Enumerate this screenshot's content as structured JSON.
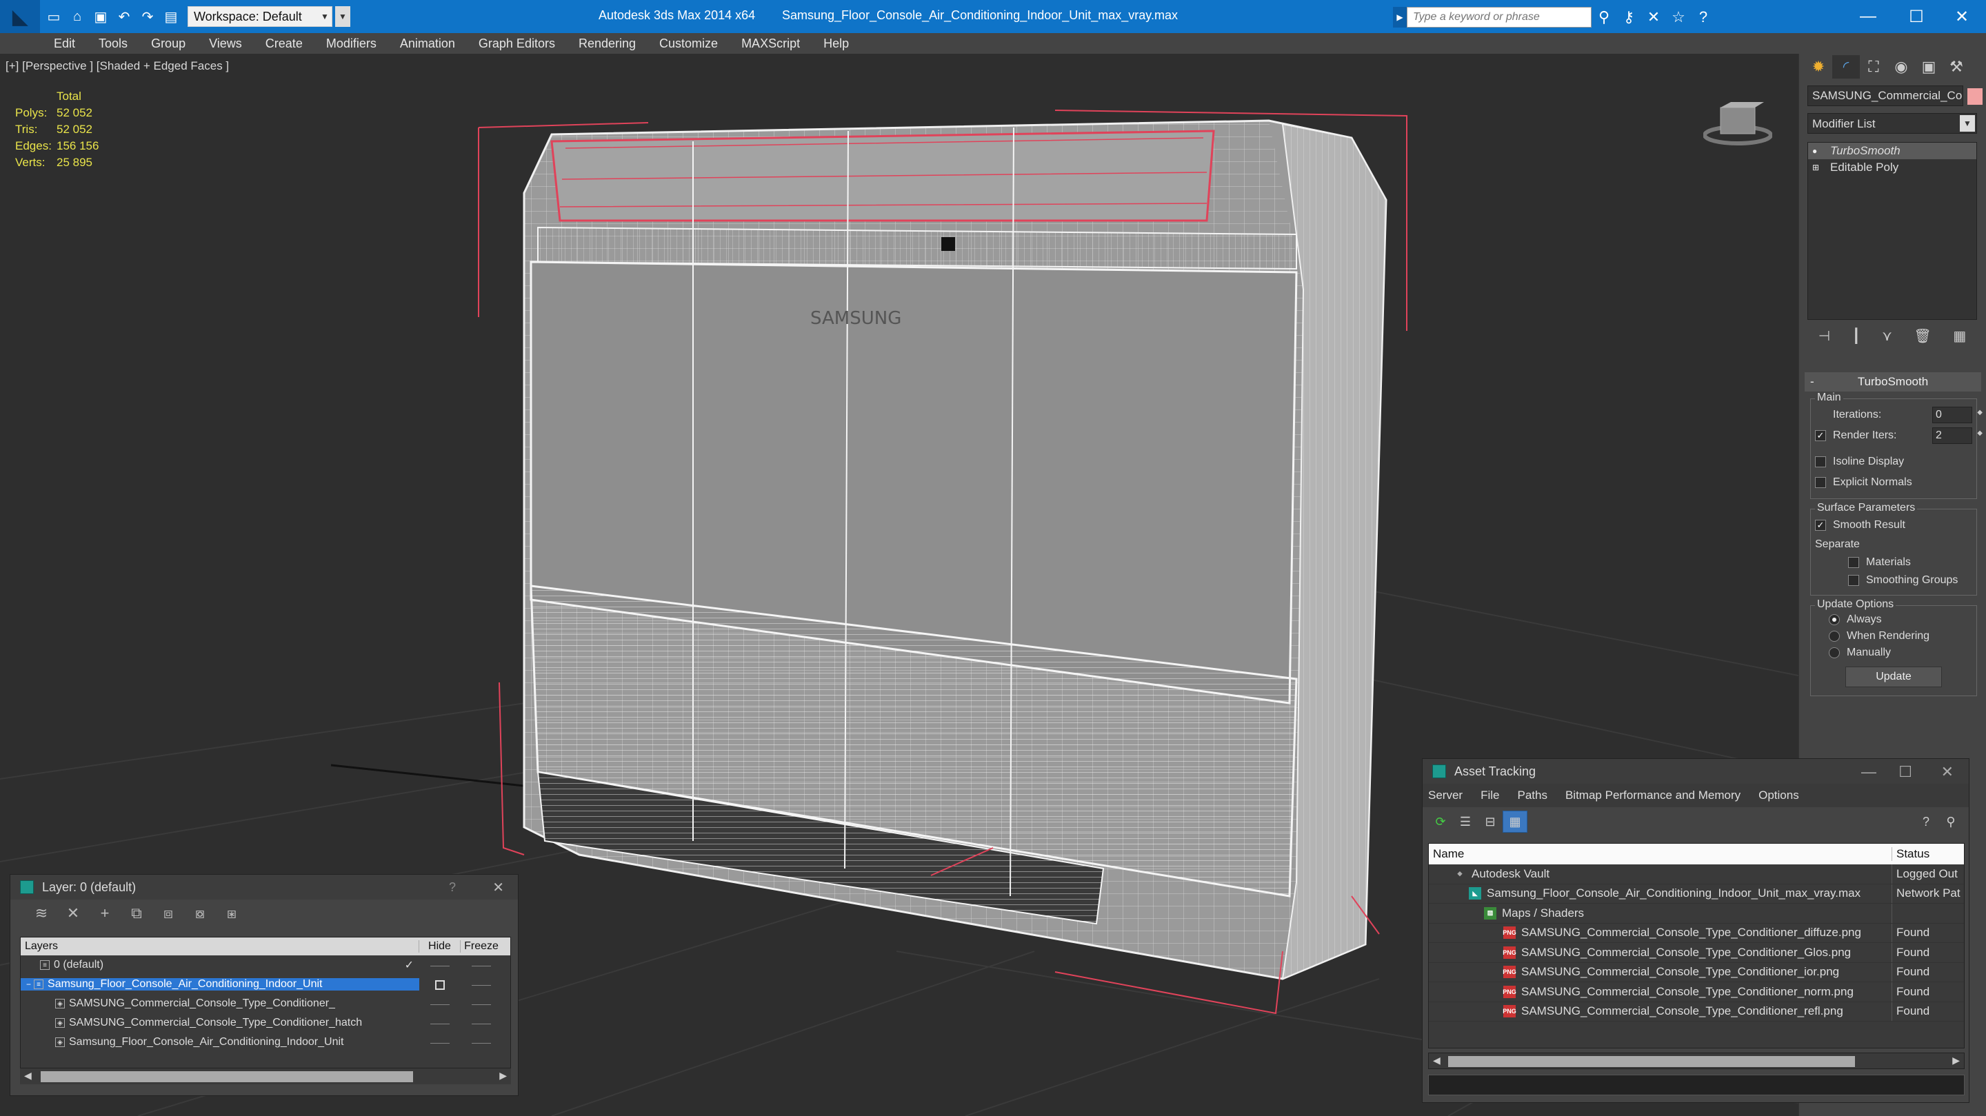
{
  "window": {
    "app_title": "Autodesk 3ds Max  2014 x64",
    "file_title": "Samsung_Floor_Console_Air_Conditioning_Indoor_Unit_max_vray.max",
    "workspace_label": "Workspace: Default",
    "search_placeholder": "Type a keyword or phrase"
  },
  "menu": [
    "Edit",
    "Tools",
    "Group",
    "Views",
    "Create",
    "Modifiers",
    "Animation",
    "Graph Editors",
    "Rendering",
    "Customize",
    "MAXScript",
    "Help"
  ],
  "viewport": {
    "label": "[+] [Perspective ] [Shaded + Edged Faces ]",
    "stats_total": "Total",
    "stats": [
      {
        "key": "Polys:",
        "value": "52 052"
      },
      {
        "key": "Tris:",
        "value": "52 052"
      },
      {
        "key": "Edges:",
        "value": "156 156"
      },
      {
        "key": "Verts:",
        "value": "25 895"
      }
    ]
  },
  "command_panel": {
    "object_name": "SAMSUNG_Commercial_Conso",
    "object_color": "#f2a3a3",
    "modifier_list": "Modifier List",
    "stack": [
      "TurboSmooth",
      "Editable Poly"
    ],
    "rollout_title": "TurboSmooth",
    "main_group": "Main",
    "iterations_label": "Iterations:",
    "iterations_value": "0",
    "render_iters_label": "Render Iters:",
    "render_iters_value": "2",
    "render_iters_checked": true,
    "isoline_label": "Isoline Display",
    "explicit_normals_label": "Explicit Normals",
    "surface_group": "Surface Parameters",
    "smooth_result_label": "Smooth Result",
    "separate_label": "Separate",
    "materials_label": "Materials",
    "smoothing_groups_label": "Smoothing Groups",
    "update_group": "Update Options",
    "update_always": "Always",
    "update_when_rendering": "When Rendering",
    "update_manually": "Manually",
    "update_button": "Update"
  },
  "layer_window": {
    "title": "Layer: 0 (default)",
    "help": "?",
    "columns": {
      "layers": "Layers",
      "hide": "Hide",
      "freeze": "Freeze"
    },
    "rows": [
      {
        "name": "0 (default)",
        "indent": 1,
        "selected": false
      },
      {
        "name": "Samsung_Floor_Console_Air_Conditioning_Indoor_Unit",
        "indent": 1,
        "selected": true
      },
      {
        "name": "SAMSUNG_Commercial_Console_Type_Conditioner_",
        "indent": 2,
        "selected": false
      },
      {
        "name": "SAMSUNG_Commercial_Console_Type_Conditioner_hatch",
        "indent": 2,
        "selected": false
      },
      {
        "name": "Samsung_Floor_Console_Air_Conditioning_Indoor_Unit",
        "indent": 2,
        "selected": false
      }
    ]
  },
  "asset_window": {
    "title": "Asset Tracking",
    "menu": [
      "Server",
      "File",
      "Paths",
      "Bitmap Performance and Memory",
      "Options"
    ],
    "columns": {
      "name": "Name",
      "status": "Status"
    },
    "rows": [
      {
        "name": "Autodesk Vault",
        "status": "Logged Out",
        "indent": 1,
        "icon": "vault"
      },
      {
        "name": "Samsung_Floor_Console_Air_Conditioning_Indoor_Unit_max_vray.max",
        "status": "Network Pat",
        "indent": 2,
        "icon": "max"
      },
      {
        "name": "Maps / Shaders",
        "status": "",
        "indent": 3,
        "icon": "maps"
      },
      {
        "name": "SAMSUNG_Commercial_Console_Type_Conditioner_diffuze.png",
        "status": "Found",
        "indent": 4,
        "icon": "png"
      },
      {
        "name": "SAMSUNG_Commercial_Console_Type_Conditioner_Glos.png",
        "status": "Found",
        "indent": 4,
        "icon": "png"
      },
      {
        "name": "SAMSUNG_Commercial_Console_Type_Conditioner_ior.png",
        "status": "Found",
        "indent": 4,
        "icon": "png"
      },
      {
        "name": "SAMSUNG_Commercial_Console_Type_Conditioner_norm.png",
        "status": "Found",
        "indent": 4,
        "icon": "png"
      },
      {
        "name": "SAMSUNG_Commercial_Console_Type_Conditioner_refl.png",
        "status": "Found",
        "indent": 4,
        "icon": "png"
      }
    ]
  }
}
